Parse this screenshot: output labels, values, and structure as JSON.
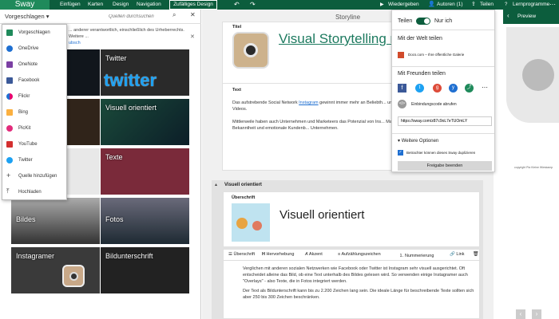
{
  "topbar": {
    "logo": "Sway",
    "menu": [
      "Einfügen",
      "Karten",
      "Design",
      "Navigation"
    ],
    "design_button": "Zufälliges Design",
    "play": "Wiedergeben",
    "authors": "Autoren (1)",
    "share": "Teilen",
    "learn": "Lernprogramme"
  },
  "left": {
    "dropdown_label": "Vorgeschlagen",
    "search_placeholder": "Quellen durchsuchen",
    "notice": "... anderer verantwortlich, einschließlich des Urheberrechts. Weitere ...",
    "notice_link": "ubsch",
    "tiles": [
      "Twitter",
      "Visuell orientiert",
      "Texte",
      "Bildes",
      "Fotos",
      "Instagramer",
      "Bildunterschrift"
    ],
    "menu_items": [
      {
        "label": "Vorgeschlagen",
        "color": "#1f8a5b"
      },
      {
        "label": "OneDrive",
        "color": "#1e6fd1"
      },
      {
        "label": "OneNote",
        "color": "#7b3fa3"
      },
      {
        "label": "Facebook",
        "color": "#3b5998"
      },
      {
        "label": "Flickr",
        "color": "#e5006f"
      },
      {
        "label": "Bing",
        "color": "#fbb040"
      },
      {
        "label": "PicKit",
        "color": "#e22b7b"
      },
      {
        "label": "YouTube",
        "color": "#d32f2f"
      },
      {
        "label": "Twitter",
        "color": "#1da1f2"
      },
      {
        "label": "Quelle hinzufügen",
        "color": "#444444"
      },
      {
        "label": "Hochladen",
        "color": "#444444"
      }
    ]
  },
  "center": {
    "storyline": "Storyline",
    "card1_label": "Titel",
    "card1_title": "Visual Storytelling m",
    "text_label": "Text",
    "text_p1_pre": "Das aufstrebende Social Network ",
    "text_p1_link": "Instagram",
    "text_p1_post": " gewinnt immer mehr an Beliebth... und erzählen ihr Leben in Bildern und Videos.",
    "text_p2": "Mittlerweile haben auch Unternehmen und Marketeers das Potenzial von Ins... Marketing-Instrument für Storytelling, Bekanntheit und emotionale Kundenb... Unternehmen.",
    "section_label": "Visuell orientiert",
    "heading_label": "Überschrift",
    "heading_title": "Visuell orientiert",
    "toolbar": [
      "Überschrift",
      "Hervorhebung",
      "Akzent",
      "Aufzählungszeichen",
      "Nummerierung",
      "Link"
    ],
    "body_p1": "Verglichen mit anderen sozialen Netzwerken wie Facebook oder Twitter ist Instagram sehr visuell ausgerichtet. Oft entscheidet alleine das Bild, ob eine Text unterhalb des Bildes gelesen wird. So verwenden einige Instagramer auch \"Overlays\" - also Texte, die in Fotos integriert werden.",
    "body_p2": "Der Text als Bildunterschrift kann bis zu 2.200 Zeichen lang sein. Die ideale Länge für beschreibende Texte sollten sich aber 250  bis 300 Zeichen beschränken."
  },
  "share": {
    "label": "Teilen",
    "toggle_label": "Nur ich",
    "world": "Mit der Welt teilen",
    "docs": "Docs.com – Ihre öffentliche Galerie",
    "friends": "Mit Freunden teilen",
    "embed": "Einbindungscode abrufen",
    "url": "https://sway.com/z87c9oL7eTUOmLY",
    "advanced": "Weitere Optionen",
    "checkbox": "Betrachter können dieses Sway duplizieren",
    "end": "Freigabe beenden"
  },
  "right": {
    "preview": "Preview",
    "copyright": "copyright Pia Kleine Wieskamp"
  }
}
